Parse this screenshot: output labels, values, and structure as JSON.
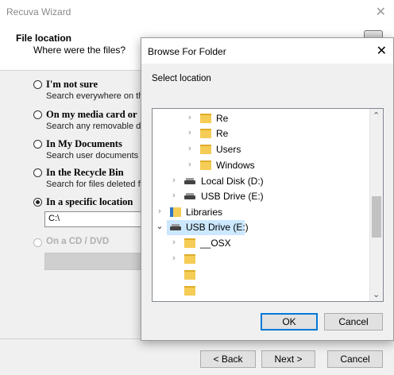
{
  "wizard": {
    "title": "Recuva Wizard",
    "close_glyph": "✕",
    "header_title": "File location",
    "header_subtitle": "Where were the files?",
    "logo_icon": "recuva-logo-icon",
    "options": [
      {
        "label": "I'm not sure",
        "desc": "Search everywhere on th",
        "selected": false,
        "enabled": true
      },
      {
        "label": "On my media card or",
        "desc": "Search any removable dr",
        "selected": false,
        "enabled": true
      },
      {
        "label": "In My Documents",
        "desc": "Search user documents f",
        "selected": false,
        "enabled": true
      },
      {
        "label": "In the Recycle Bin",
        "desc": "Search for files deleted fi",
        "selected": false,
        "enabled": true
      },
      {
        "label": "In a specific location",
        "desc": "",
        "selected": true,
        "enabled": true
      },
      {
        "label": "On a CD / DVD",
        "desc": "",
        "selected": false,
        "enabled": false
      }
    ],
    "location_value": "C:\\",
    "back_label": "< Back",
    "next_label": "Next >",
    "cancel_label": "Cancel"
  },
  "dialog": {
    "title": "Browse For Folder",
    "close_glyph": "✕",
    "select_label": "Select location",
    "tree": [
      {
        "label": "Re",
        "icon": "folder-icon",
        "expander": "›"
      },
      {
        "label": "Re",
        "icon": "folder-icon",
        "expander": "›"
      },
      {
        "label": "Users",
        "icon": "folder-icon",
        "expander": "›"
      },
      {
        "label": "Windows",
        "icon": "folder-icon",
        "expander": "›"
      },
      {
        "label": "Local Disk (D:)",
        "icon": "drive-icon",
        "expander": "›"
      },
      {
        "label": "USB Drive (E:)",
        "icon": "drive-icon",
        "expander": "›"
      },
      {
        "label": "Libraries",
        "icon": "libraries-icon",
        "expander": "›"
      },
      {
        "label": "USB Drive (E:)",
        "icon": "drive-icon",
        "expander": "⌄",
        "selected": true
      },
      {
        "label": "__OSX",
        "icon": "folder-icon",
        "expander": "›"
      },
      {
        "label": "",
        "icon": "folder-icon",
        "expander": "›"
      },
      {
        "label": "",
        "icon": "folder-icon",
        "expander": ""
      },
      {
        "label": "",
        "icon": "folder-icon",
        "expander": ""
      }
    ],
    "ok_label": "OK",
    "cancel_label": "Cancel"
  },
  "colors": {
    "selection": "#cce8ff",
    "accent": "#0078d7",
    "folder": "#f5cc55"
  }
}
